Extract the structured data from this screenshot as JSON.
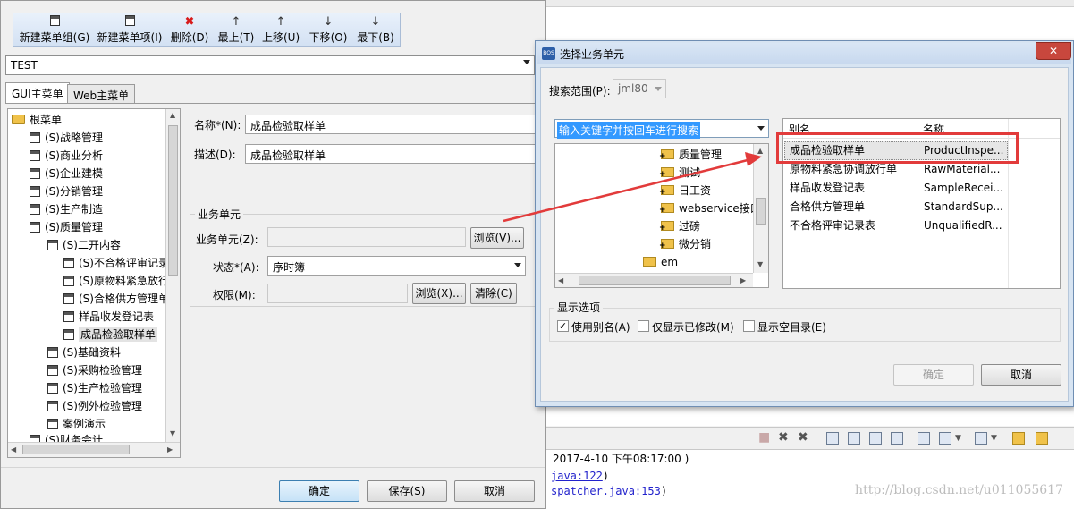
{
  "toolbar": {
    "new_group": "新建菜单组(G)",
    "new_item": "新建菜单项(I)",
    "delete": "删除(D)",
    "top": "最上(T)",
    "up": "上移(U)",
    "down": "下移(O)",
    "bottom": "最下(B)"
  },
  "menu_combo": {
    "value": "TEST"
  },
  "tabs": {
    "gui": "GUI主菜单",
    "web": "Web主菜单"
  },
  "tree": {
    "root": "根菜单",
    "items": [
      "(S)战略管理",
      "(S)商业分析",
      "(S)企业建模",
      "(S)分销管理",
      "(S)生产制造",
      "(S)质量管理",
      "(S)二开内容",
      "(S)不合格评审记录",
      "(S)原物料紧急放行",
      "(S)合格供方管理单",
      "样品收发登记表",
      "成品检验取样单",
      "(S)基础资料",
      "(S)采购检验管理",
      "(S)生产检验管理",
      "(S)例外检验管理",
      "案例演示",
      "(S)财务会计"
    ]
  },
  "form": {
    "name_label": "名称*(N):",
    "name_value": "成品检验取样单",
    "desc_label": "描述(D):",
    "desc_value": "成品检验取样单",
    "group_title": "业务单元",
    "unit_label": "业务单元(Z):",
    "browse1": "浏览(V)...",
    "state_label": "状态*(A):",
    "state_value": "序时簿",
    "perm_label": "权限(M):",
    "browse2": "浏览(X)...",
    "clear": "清除(C)"
  },
  "footer": {
    "ok": "确定",
    "save": "保存(S)",
    "cancel": "取消"
  },
  "dialog": {
    "logo": "BOS",
    "title": "选择业务单元",
    "close": "✕",
    "scope_label": "搜索范围(P):",
    "scope_value": "jml80",
    "search_placeholder": "输入关键字并按回车进行搜索",
    "tree": [
      "质量管理",
      "测试",
      "日工资",
      "webservice接口",
      "过磅",
      "微分销",
      "em"
    ],
    "list_headers": {
      "alias": "别名",
      "name": "名称"
    },
    "rows": [
      {
        "alias": "成品检验取样单",
        "name": "ProductInspe..."
      },
      {
        "alias": "原物料紧急协调放行单",
        "name": "RawMaterial..."
      },
      {
        "alias": "样品收发登记表",
        "name": "SampleRecei..."
      },
      {
        "alias": "合格供方管理单",
        "name": "StandardSup..."
      },
      {
        "alias": "不合格评审记录表",
        "name": "UnqualifiedR..."
      }
    ],
    "display_options": "显示选项",
    "opt_alias": "使用别名(A)",
    "opt_modified": "仅显示已修改(M)",
    "opt_empty": "显示空目录(E)",
    "ok": "确定",
    "cancel": "取消"
  },
  "console": {
    "timestamp": "2017-4-10 下午08:17:00 )",
    "line1_link": "java:122",
    "line1_tail": ")",
    "line2_link": "spatcher.java:153",
    "line2_tail": ")"
  },
  "watermark": "http://blog.csdn.net/u011055617",
  "colors": {
    "highlight_red": "#e23b3b",
    "selection_blue": "#3399ff",
    "dialog_frame": "#d7e4f2"
  }
}
